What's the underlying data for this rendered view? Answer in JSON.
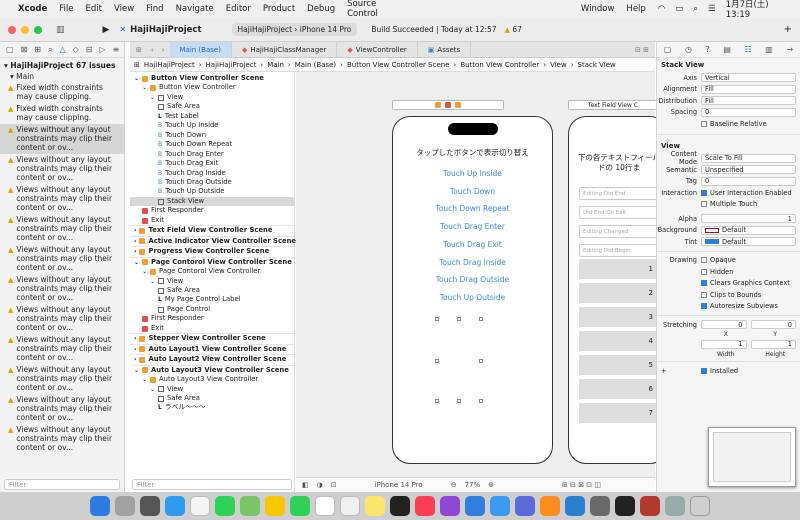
{
  "menubar": {
    "app": "Xcode",
    "items": [
      "File",
      "Edit",
      "View",
      "Find",
      "Navigate",
      "Editor",
      "Product",
      "Debug",
      "Source Control",
      "Window",
      "Help"
    ],
    "clock": "1月7日(土) 13:19"
  },
  "toolbar": {
    "project": "HajiHajiProject",
    "target": "HajiHajiProject",
    "device": "iPhone 14 Pro",
    "status": "Build Succeeded | Today at 12:57",
    "warnings": "67"
  },
  "tabs": [
    "Main (Base)",
    "HajiHajiClassManager",
    "ViewController",
    "Assets"
  ],
  "jumpbar": [
    "HajiHajiProject",
    "HajiHajiProject",
    "Main",
    "Main (Base)",
    "Button View Controller Scene",
    "Button View Controller",
    "View",
    "Stack View"
  ],
  "navigator": {
    "project_row": "HajiHajiProject 67 issues",
    "group": "Main",
    "filter_placeholder": "Filter",
    "issues": [
      {
        "text": "Fixed width constraints may cause clipping.",
        "sel": false
      },
      {
        "text": "Fixed width constraints may cause clipping.",
        "sel": false
      },
      {
        "text": "Views without any layout constraints may clip their content or ov...",
        "sel": true
      },
      {
        "text": "Views without any layout constraints may clip their content or ov...",
        "sel": false
      },
      {
        "text": "Views without any layout constraints may clip their content or ov...",
        "sel": false
      },
      {
        "text": "Views without any layout constraints may clip their content or ov...",
        "sel": false
      },
      {
        "text": "Views without any layout constraints may clip their content or ov...",
        "sel": false
      },
      {
        "text": "Views without any layout constraints may clip their content or ov...",
        "sel": false
      },
      {
        "text": "Views without any layout constraints may clip their content or ov...",
        "sel": false
      },
      {
        "text": "Views without any layout constraints may clip their content or ov...",
        "sel": false
      },
      {
        "text": "Views without any layout constraints may clip their content or ov...",
        "sel": false
      },
      {
        "text": "Views without any layout constraints may clip their content or ov...",
        "sel": false
      },
      {
        "text": "Views without any layout constraints may clip their content or ov...",
        "sel": false
      }
    ]
  },
  "outline": [
    {
      "t": "Button View Controller Scene",
      "d": 0,
      "i": "scene"
    },
    {
      "t": "Button View Controller",
      "d": 1,
      "i": "vc"
    },
    {
      "t": "View",
      "d": 2,
      "i": "view"
    },
    {
      "t": "Safe Area",
      "d": 3,
      "i": "view"
    },
    {
      "t": "Test Label",
      "d": 3,
      "i": "label"
    },
    {
      "t": "Touch Up Inside",
      "d": 3,
      "i": "btn"
    },
    {
      "t": "Touch Down",
      "d": 3,
      "i": "btn"
    },
    {
      "t": "Touch Down Repeat",
      "d": 3,
      "i": "btn"
    },
    {
      "t": "Touch Drag Enter",
      "d": 3,
      "i": "btn"
    },
    {
      "t": "Touch Drag Exit",
      "d": 3,
      "i": "btn"
    },
    {
      "t": "Touch Drag Inside",
      "d": 3,
      "i": "btn"
    },
    {
      "t": "Touch Drag Outside",
      "d": 3,
      "i": "btn"
    },
    {
      "t": "Touch Up Outside",
      "d": 3,
      "i": "btn"
    },
    {
      "t": "Stack View",
      "d": 3,
      "i": "view",
      "sel": true
    },
    {
      "t": "First Responder",
      "d": 1,
      "i": "fr"
    },
    {
      "t": "Exit",
      "d": 1,
      "i": "fr"
    },
    {
      "t": "Text Field View Controller Scene",
      "d": 0,
      "i": "scene",
      "sep": true
    },
    {
      "t": "Active Indicator View Controller Scene",
      "d": 0,
      "i": "scene",
      "sep": true
    },
    {
      "t": "Progress View Controller Scene",
      "d": 0,
      "i": "scene",
      "sep": true
    },
    {
      "t": "Page Contorol View Controller Scene",
      "d": 0,
      "i": "scene",
      "sep": true
    },
    {
      "t": "Page Contorol View Controller",
      "d": 1,
      "i": "vc"
    },
    {
      "t": "View",
      "d": 2,
      "i": "view"
    },
    {
      "t": "Safe Area",
      "d": 3,
      "i": "view"
    },
    {
      "t": "My Page Control Label",
      "d": 3,
      "i": "label"
    },
    {
      "t": "Page Control",
      "d": 3,
      "i": "view"
    },
    {
      "t": "First Responder",
      "d": 1,
      "i": "fr"
    },
    {
      "t": "Exit",
      "d": 1,
      "i": "fr"
    },
    {
      "t": "Stepper View Controller Scene",
      "d": 0,
      "i": "scene",
      "sep": true
    },
    {
      "t": "Auto Layout1 View Controller Scene",
      "d": 0,
      "i": "scene",
      "sep": true
    },
    {
      "t": "Auto Layout2 View Controller Scene",
      "d": 0,
      "i": "scene",
      "sep": true
    },
    {
      "t": "Auto Layout3 View Controller Scene",
      "d": 0,
      "i": "scene",
      "sep": true
    },
    {
      "t": "Auto Layout3 View Controller",
      "d": 1,
      "i": "vc"
    },
    {
      "t": "View",
      "d": 2,
      "i": "view"
    },
    {
      "t": "Safe Area",
      "d": 3,
      "i": "view"
    },
    {
      "t": "ラベル〜〜〜",
      "d": 3,
      "i": "label"
    }
  ],
  "outline_filter": "Filter",
  "canvas": {
    "phone1": {
      "title": "タップしたボタンで表示切り替え",
      "buttons": [
        "Touch Up Inside",
        "Touch Down",
        "Touch Down Repeat",
        "Touch Drag Enter",
        "Touch Drag Exit",
        "Touch Drag Inside",
        "Touch Drag Outside",
        "Touch Up Outside"
      ]
    },
    "phone2": {
      "scene_title": "Text Field View C",
      "text": "下の各テキストフィールドの 10行ま",
      "fields": [
        "Editing Did End",
        "Did End On Exit",
        "Editing Changed",
        "Editing Did Begin"
      ],
      "numbers": [
        "1",
        "2",
        "3",
        "4",
        "5",
        "6",
        "7"
      ]
    },
    "bottom": {
      "device": "iPhone 14 Pro",
      "zoom": "77%"
    }
  },
  "inspector": {
    "stack": {
      "header": "Stack View",
      "rows": [
        [
          "Axis",
          "Vertical"
        ],
        [
          "Alignment",
          "Fill"
        ],
        [
          "Distribution",
          "Fill"
        ],
        [
          "Spacing",
          "0"
        ]
      ],
      "baseline": "Baseline Relative"
    },
    "view": {
      "header": "View",
      "rows": [
        [
          "Content Mode",
          "Scale To Fill"
        ],
        [
          "Semantic",
          "Unspecified"
        ],
        [
          "Tag",
          "0"
        ]
      ],
      "interaction_label": "Interaction",
      "interaction": [
        {
          "t": "User Interaction Enabled",
          "on": true
        },
        {
          "t": "Multiple Touch",
          "on": false
        }
      ],
      "alpha_label": "Alpha",
      "alpha": "1",
      "background_label": "Background",
      "background": "Default",
      "tint_label": "Tint",
      "tint": "Default",
      "drawing_label": "Drawing",
      "drawing": [
        {
          "t": "Opaque",
          "on": false
        },
        {
          "t": "Hidden",
          "on": false
        },
        {
          "t": "Clears Graphics Context",
          "on": true
        },
        {
          "t": "Clips to Bounds",
          "on": false
        },
        {
          "t": "Autoresize Subviews",
          "on": true
        }
      ],
      "stretching_label": "Stretching",
      "stretch": [
        "0",
        "0",
        "1",
        "1"
      ],
      "stretch_labels": [
        "X",
        "Y",
        "Width",
        "Height"
      ],
      "installed": "Installed"
    }
  }
}
